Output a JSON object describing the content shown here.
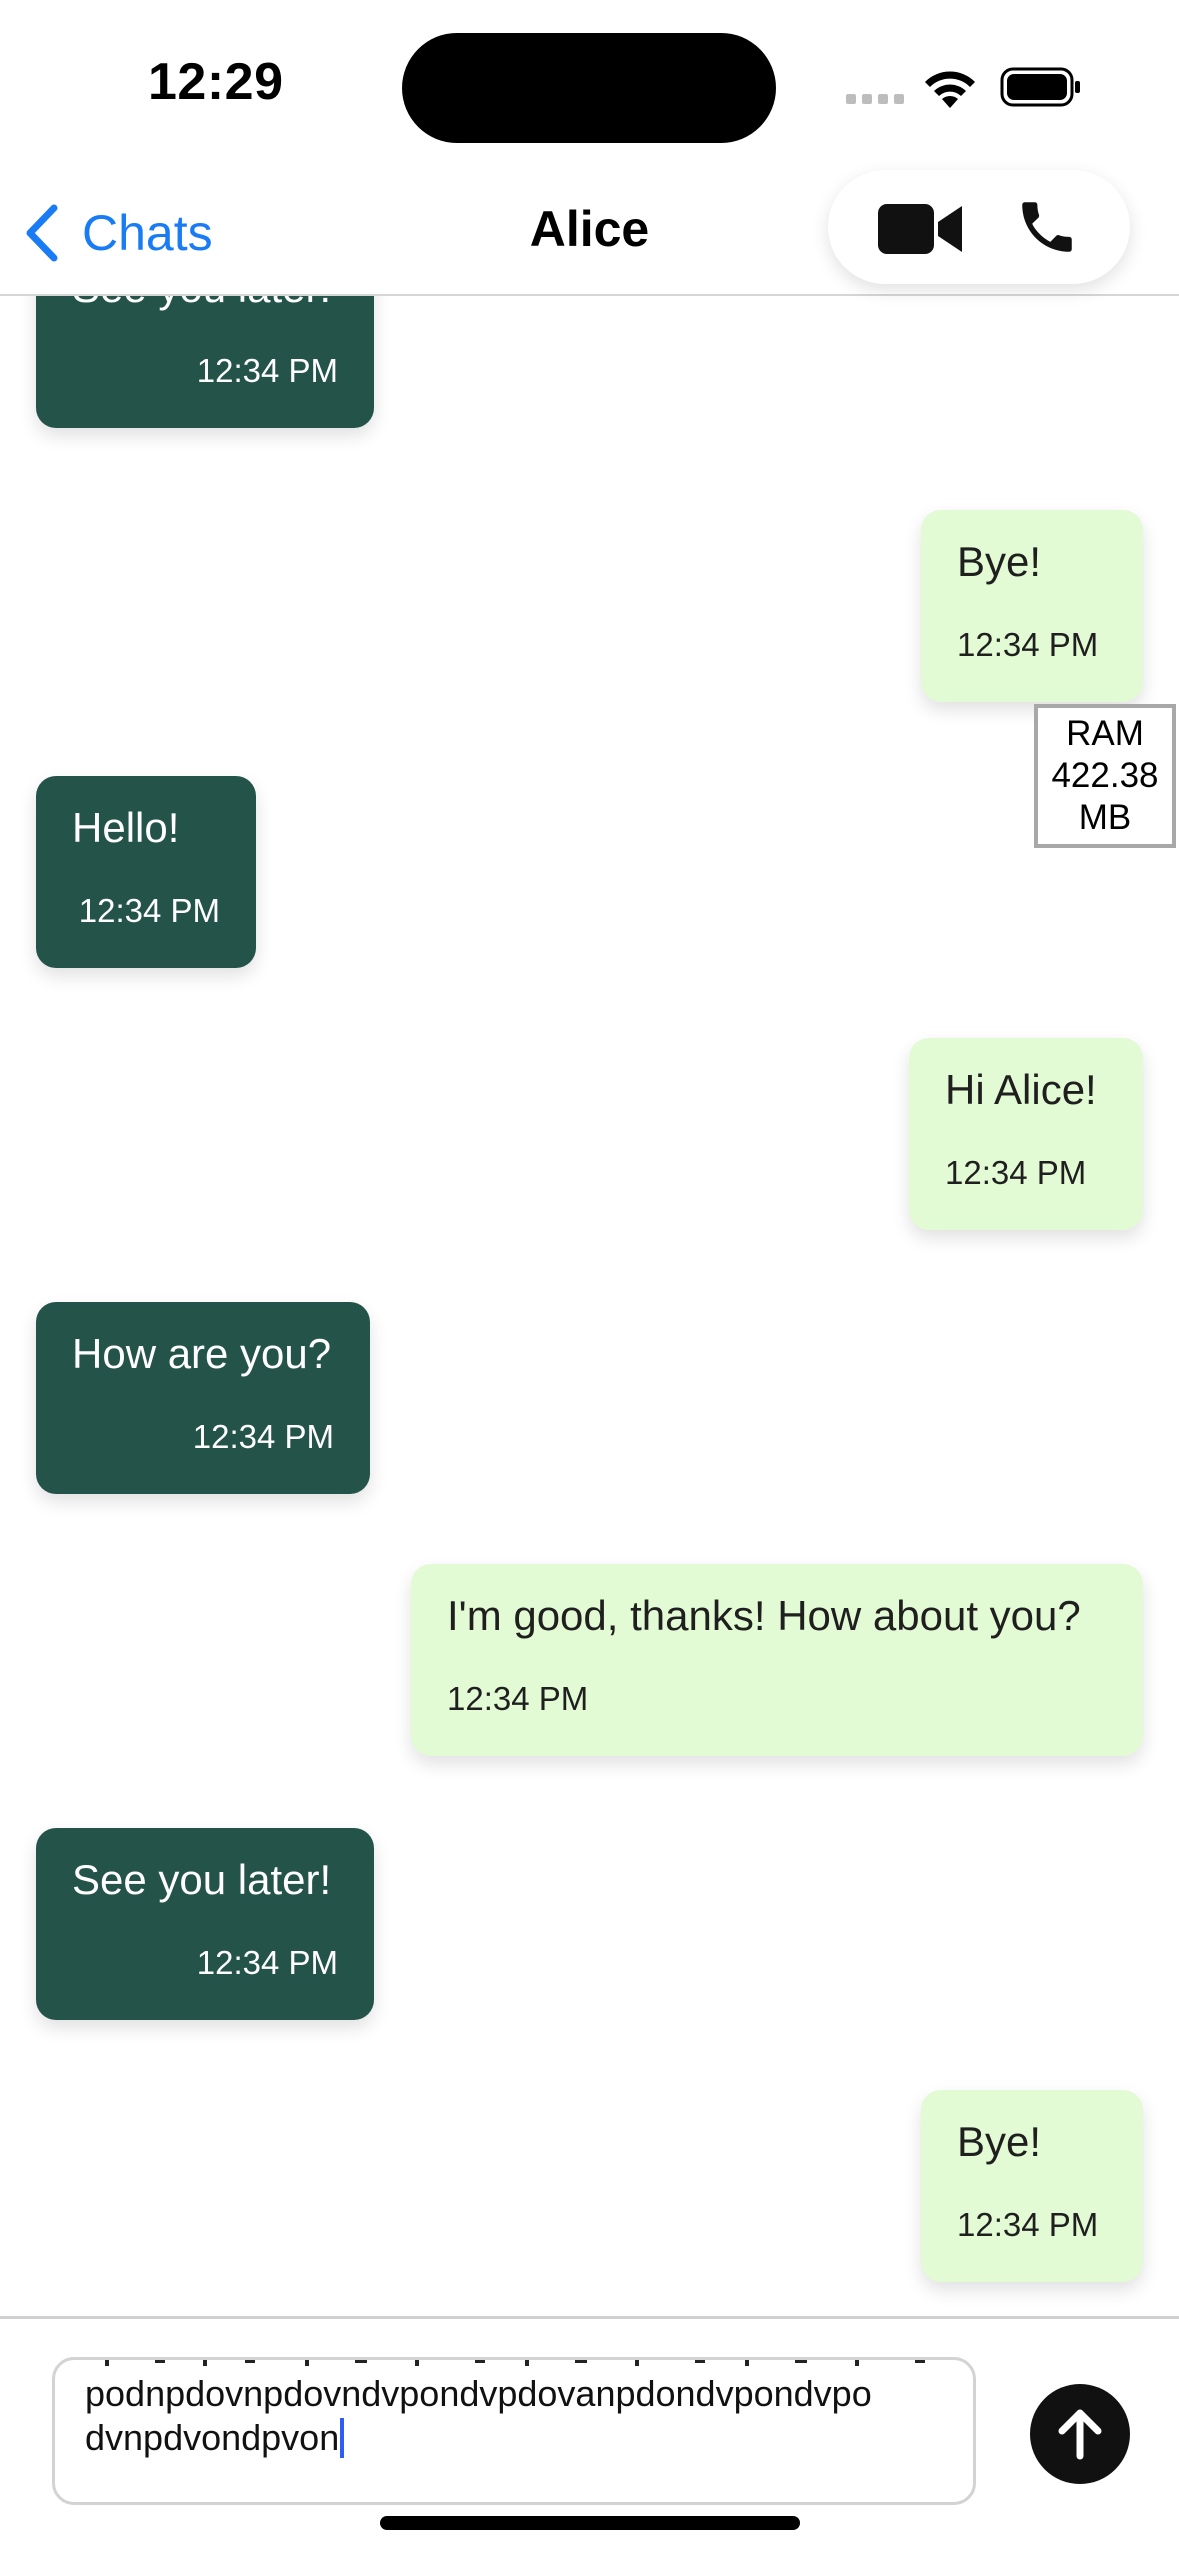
{
  "status_bar": {
    "time": "12:29"
  },
  "nav": {
    "back_label": "Chats",
    "title": "Alice"
  },
  "messages": [
    {
      "dir": "in",
      "text": "See you later!",
      "time": "12:34 PM"
    },
    {
      "dir": "out",
      "text": "Bye!",
      "time": "12:34 PM"
    },
    {
      "dir": "in",
      "text": "Hello!",
      "time": "12:34 PM"
    },
    {
      "dir": "out",
      "text": "Hi Alice!",
      "time": "12:34 PM"
    },
    {
      "dir": "in",
      "text": "How are you?",
      "time": "12:34 PM"
    },
    {
      "dir": "out",
      "text": "I'm good, thanks! How about you?",
      "time": "12:34 PM"
    },
    {
      "dir": "in",
      "text": "See you later!",
      "time": "12:34 PM"
    },
    {
      "dir": "out",
      "text": "Bye!",
      "time": "12:34 PM"
    }
  ],
  "ram_overlay": {
    "line1": "RAM",
    "line2": "422.38",
    "line3": "MB"
  },
  "composer": {
    "line1": "podnpdovnpdovndvpondvpdovanpdondvpondvpo",
    "line2": "dvnpdvondpvon"
  },
  "colors": {
    "accent": "#1a7cf5",
    "incoming_bubble": "#24534a",
    "outgoing_bubble": "#e3fbd4"
  }
}
